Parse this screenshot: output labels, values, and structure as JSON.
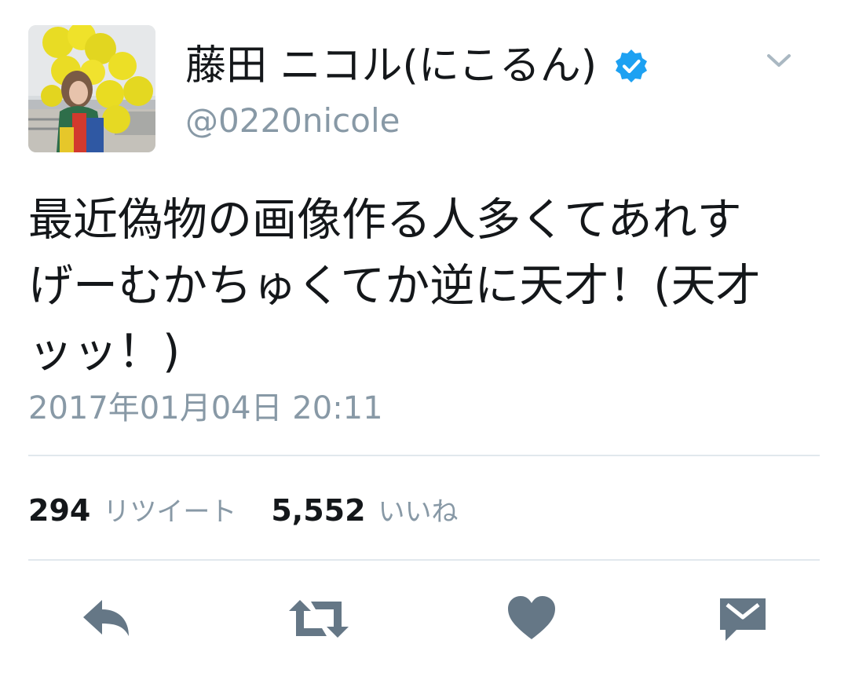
{
  "tweet": {
    "display_name": "藤田 ニコル(にこるん)",
    "handle": "@0220nicole",
    "text_lines": [
      "最近偽物の画像作る人多くてあれす",
      "げーむかちゅくてか逆に天才！(天才",
      "ッッ！)"
    ],
    "timestamp": "2017年01月04日 20:11"
  },
  "stats": {
    "retweet_count": "294",
    "retweet_label": "リツイート",
    "like_count": "5,552",
    "like_label": "いいね"
  },
  "icons": {
    "verified": "verified-badge-icon",
    "menu": "chevron-down-icon",
    "reply": "reply-icon",
    "retweet": "retweet-icon",
    "like": "heart-icon",
    "message": "direct-message-icon"
  },
  "colors": {
    "verified_blue": "#1da1f2",
    "muted_text": "#8899a6",
    "icon_gray": "#657786",
    "divider": "#e1e8ed"
  }
}
